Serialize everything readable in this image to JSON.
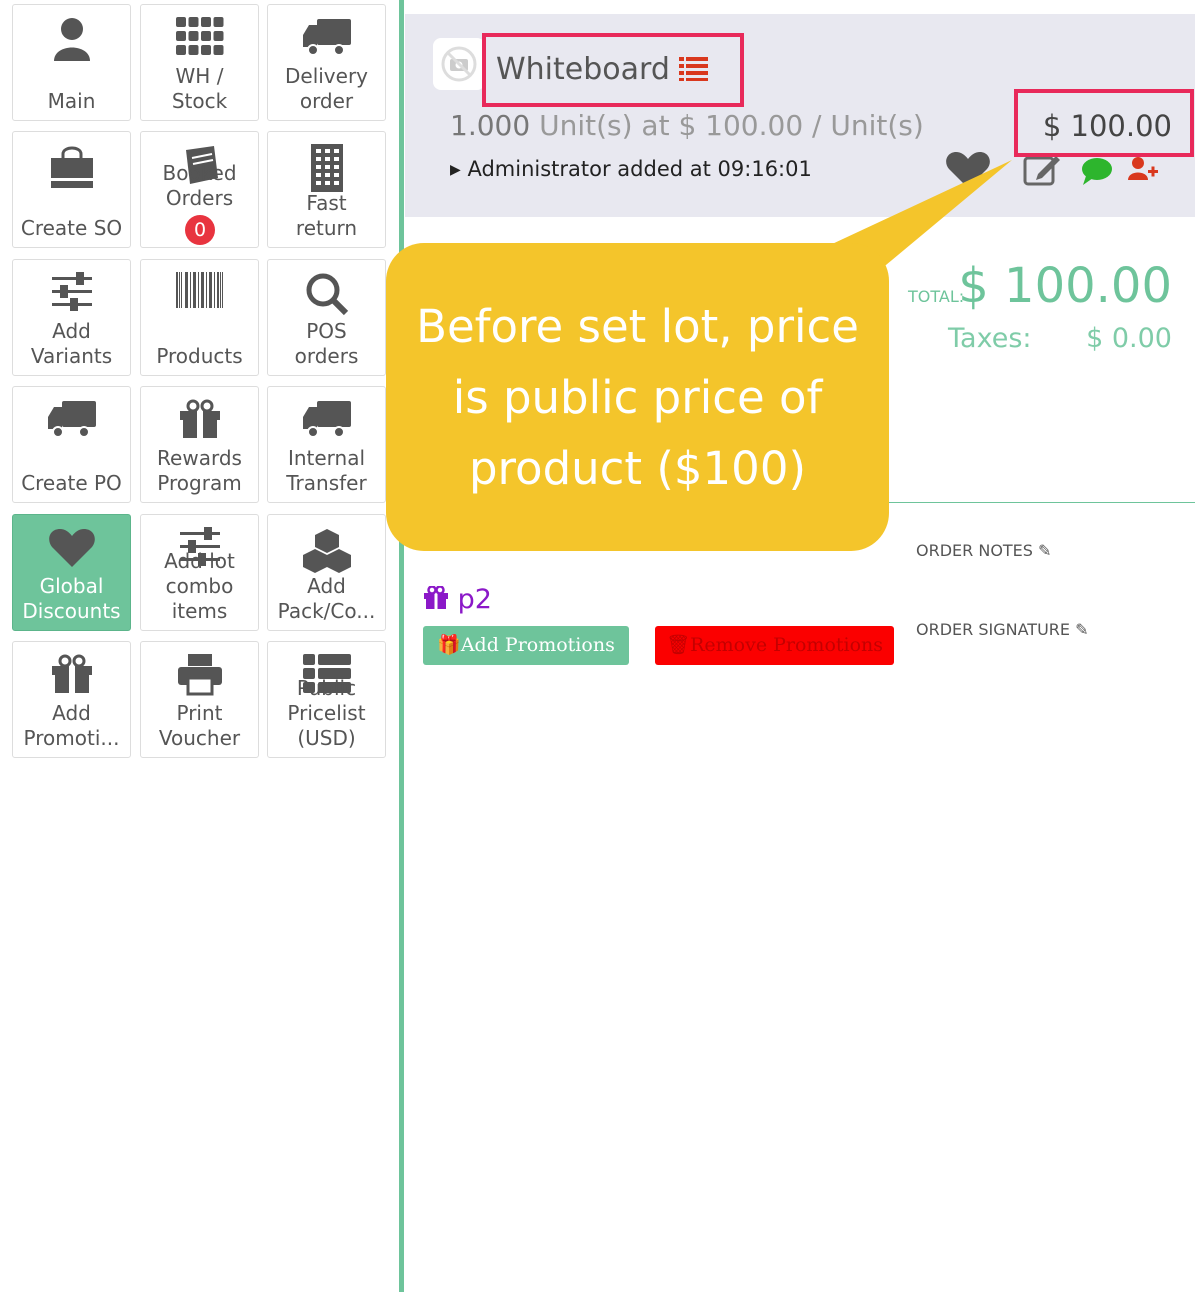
{
  "tiles": [
    {
      "label": "Main",
      "icon": "user-icon",
      "active": false
    },
    {
      "label": "WH /\nStock",
      "icon": "grid-icon",
      "active": false
    },
    {
      "label": "Delivery\norder",
      "icon": "truck-icon",
      "active": false
    },
    {
      "label": "Create SO",
      "icon": "shopping-bag-icon",
      "active": false
    },
    {
      "label": "Booked\nOrders",
      "icon": "book-icon",
      "badge": "0",
      "active": false
    },
    {
      "label": "Fast\nreturn",
      "icon": "building-icon",
      "active": false
    },
    {
      "label": "Add\nVariants",
      "icon": "sliders-icon",
      "active": false
    },
    {
      "label": "Products",
      "icon": "barcode-icon",
      "active": false
    },
    {
      "label": "POS\norders",
      "icon": "search-icon",
      "active": false
    },
    {
      "label": "Create PO",
      "icon": "truck-icon",
      "active": false
    },
    {
      "label": "Rewards\nProgram",
      "icon": "gift-icon",
      "active": false
    },
    {
      "label": "Internal\nTransfer",
      "icon": "truck-icon",
      "active": false
    },
    {
      "label": "Global\nDiscounts",
      "icon": "heart-icon",
      "active": true
    },
    {
      "label": "Add lot\ncombo\nitems",
      "icon": "sliders-icon",
      "active": false
    },
    {
      "label": "Add\nPack/Co...",
      "icon": "cubes-icon",
      "active": false
    },
    {
      "label": "Add\nPromoti...",
      "icon": "gift-icon",
      "active": false
    },
    {
      "label": "Print\nVoucher",
      "icon": "printer-icon",
      "active": false
    },
    {
      "label": "Public\nPricelist\n(USD)",
      "icon": "list-icon",
      "active": false
    }
  ],
  "orderline": {
    "product_name": "Whiteboard",
    "qty": "1.000",
    "unit_text": "Unit(s) at $ 100.00 / Unit(s)",
    "price": "$ 100.00",
    "added_by": "Administrator added at 09:16:01"
  },
  "totals": {
    "total_label": "TOTAL:",
    "total_value": "$ 100.00",
    "taxes_label": "Taxes:",
    "taxes_value": "$ 0.00"
  },
  "order_notes_label": "ORDER NOTES",
  "order_signature_label": "ORDER SIGNATURE",
  "promotion_name": "p2",
  "add_promotions_label": "Add Promotions",
  "remove_promotions_label": "Remove Promotions",
  "callout_text": "Before set lot, price is public price of product ($100)",
  "colors": {
    "accent": "#6ec49b",
    "highlight": "#e8295a",
    "callout": "#f4c52b",
    "danger": "#fb0000",
    "promo": "#8b18c8"
  }
}
